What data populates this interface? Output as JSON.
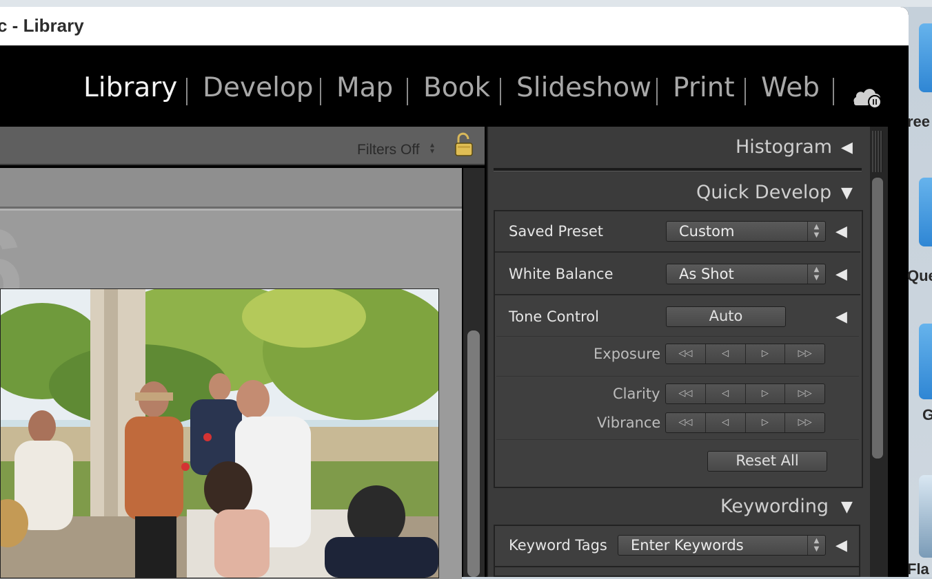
{
  "window": {
    "title": "c - Library"
  },
  "modules": [
    {
      "label": "Library",
      "active": true
    },
    {
      "label": "Develop",
      "active": false
    },
    {
      "label": "Map",
      "active": false
    },
    {
      "label": "Book",
      "active": false
    },
    {
      "label": "Slideshow",
      "active": false
    },
    {
      "label": "Print",
      "active": false
    },
    {
      "label": "Web",
      "active": false
    }
  ],
  "filter_bar": {
    "status": "Filters Off"
  },
  "grid": {
    "cell_number": "6"
  },
  "right_panel": {
    "histogram": {
      "title": "Histogram"
    },
    "quick_develop": {
      "title": "Quick Develop",
      "saved_preset": {
        "label": "Saved Preset",
        "value": "Custom"
      },
      "white_balance": {
        "label": "White Balance",
        "value": "As Shot"
      },
      "tone_control": {
        "label": "Tone Control",
        "button": "Auto"
      },
      "exposure": {
        "label": "Exposure"
      },
      "clarity": {
        "label": "Clarity"
      },
      "vibrance": {
        "label": "Vibrance"
      },
      "reset_all": "Reset All"
    },
    "keywording": {
      "title": "Keywording",
      "keyword_tags": {
        "label": "Keyword Tags",
        "value": "Enter Keywords"
      }
    }
  },
  "desktop_labels": [
    "ree",
    "Que",
    "G",
    "Fla"
  ],
  "colors": {
    "active_module": "#f4f4f4",
    "inactive_module": "#a8a8a8",
    "panel_bg": "#3b3b3b"
  }
}
